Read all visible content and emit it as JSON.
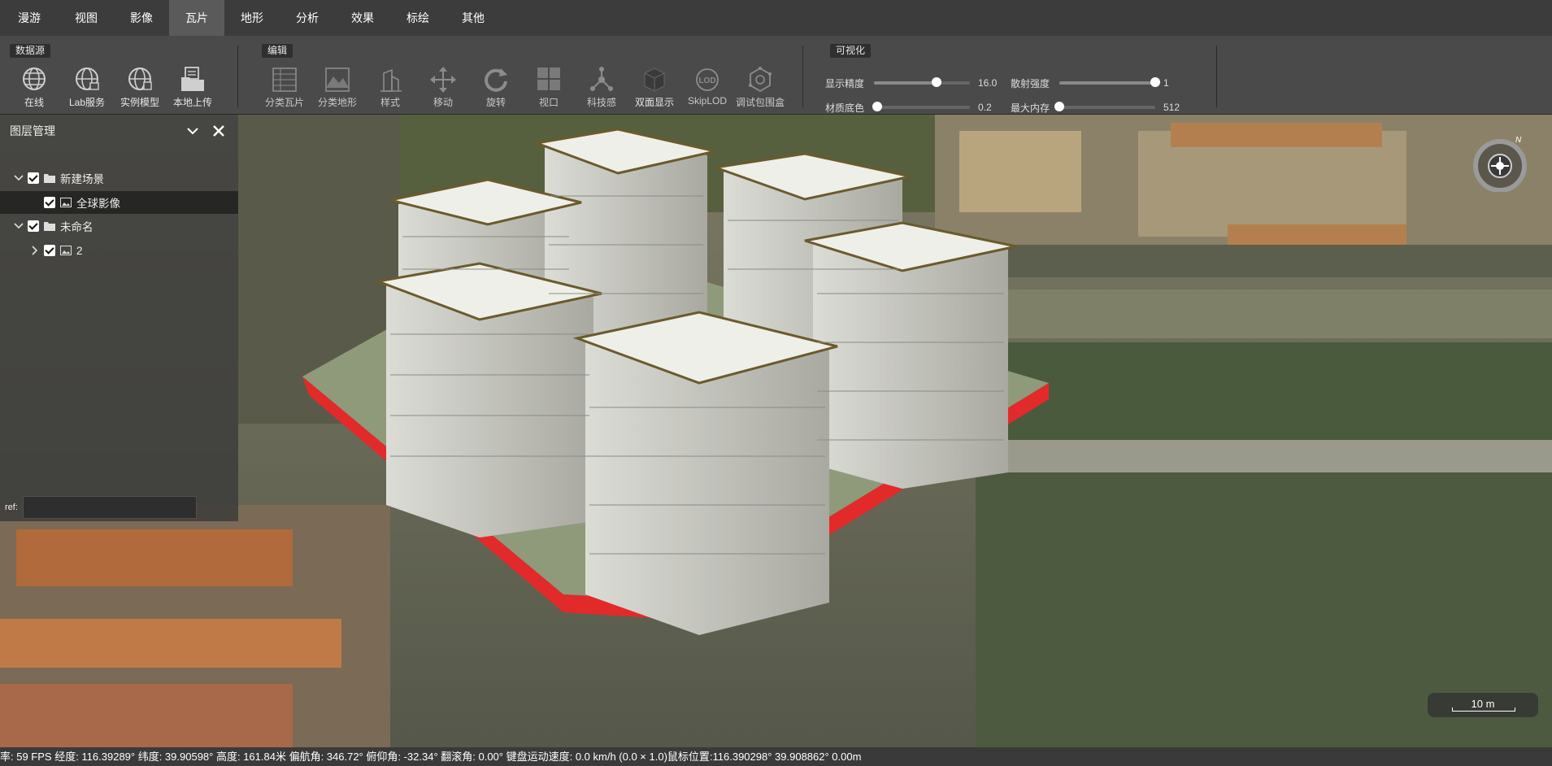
{
  "menu": {
    "items": [
      "漫游",
      "视图",
      "影像",
      "瓦片",
      "地形",
      "分析",
      "效果",
      "标绘",
      "其他"
    ],
    "active": "瓦片"
  },
  "ribbon": {
    "datasource": {
      "title": "数据源",
      "tools": [
        {
          "label": "在线",
          "icon": "globe-icon"
        },
        {
          "label": "Lab服务",
          "icon": "globe-lab-icon"
        },
        {
          "label": "实例模型",
          "icon": "globe-model-icon"
        },
        {
          "label": "本地上传",
          "icon": "folder-upload-icon"
        }
      ]
    },
    "edit": {
      "title": "编辑",
      "tools": [
        {
          "label": "分类瓦片",
          "icon": "classify-tile-icon"
        },
        {
          "label": "分类地形",
          "icon": "classify-terrain-icon"
        },
        {
          "label": "样式",
          "icon": "style-icon"
        },
        {
          "label": "移动",
          "icon": "move-icon"
        },
        {
          "label": "旋转",
          "icon": "rotate-icon"
        },
        {
          "label": "视口",
          "icon": "viewport-icon"
        },
        {
          "label": "科技感",
          "icon": "tech-icon"
        },
        {
          "label": "双面显示",
          "icon": "double-side-icon"
        },
        {
          "label": "SkipLOD",
          "icon": "lod-icon"
        },
        {
          "label": "调试包围盒",
          "icon": "bounding-box-icon"
        }
      ]
    },
    "visual": {
      "title": "可视化",
      "sliders": [
        {
          "label": "显示精度",
          "value": "16.0",
          "fraction": 0.65
        },
        {
          "label": "散射强度",
          "value": "1",
          "fraction": 1.0
        },
        {
          "label": "材质底色",
          "value": "0.2",
          "fraction": 0.03
        },
        {
          "label": "最大内存",
          "value": "512",
          "fraction": 0.0
        }
      ]
    }
  },
  "layer_panel": {
    "title": "图层管理",
    "tree": [
      {
        "label": "新建场景",
        "icon": "folder-icon",
        "expanded": true,
        "checked": true
      },
      {
        "label": "全球影像",
        "icon": "image-icon",
        "checked": true,
        "selected": true
      },
      {
        "label": "未命名",
        "icon": "folder-icon",
        "expanded": true,
        "checked": true
      },
      {
        "label": "2",
        "icon": "image-icon",
        "expanded": false,
        "checked": true
      }
    ],
    "ref_label": "ref:",
    "ref_value": ""
  },
  "compass": {
    "north_label": "N"
  },
  "scale": {
    "label": "10 m"
  },
  "status": {
    "text": "率: 59 FPS 经度: 116.39289° 纬度: 39.90598° 高度: 161.84米 偏航角: 346.72° 俯仰角: -32.34° 翻滚角: 0.00° 键盘运动速度: 0.0 km/h (0.0 × 1.0)鼠标位置:116.390298° 39.908862° 0.00m"
  }
}
